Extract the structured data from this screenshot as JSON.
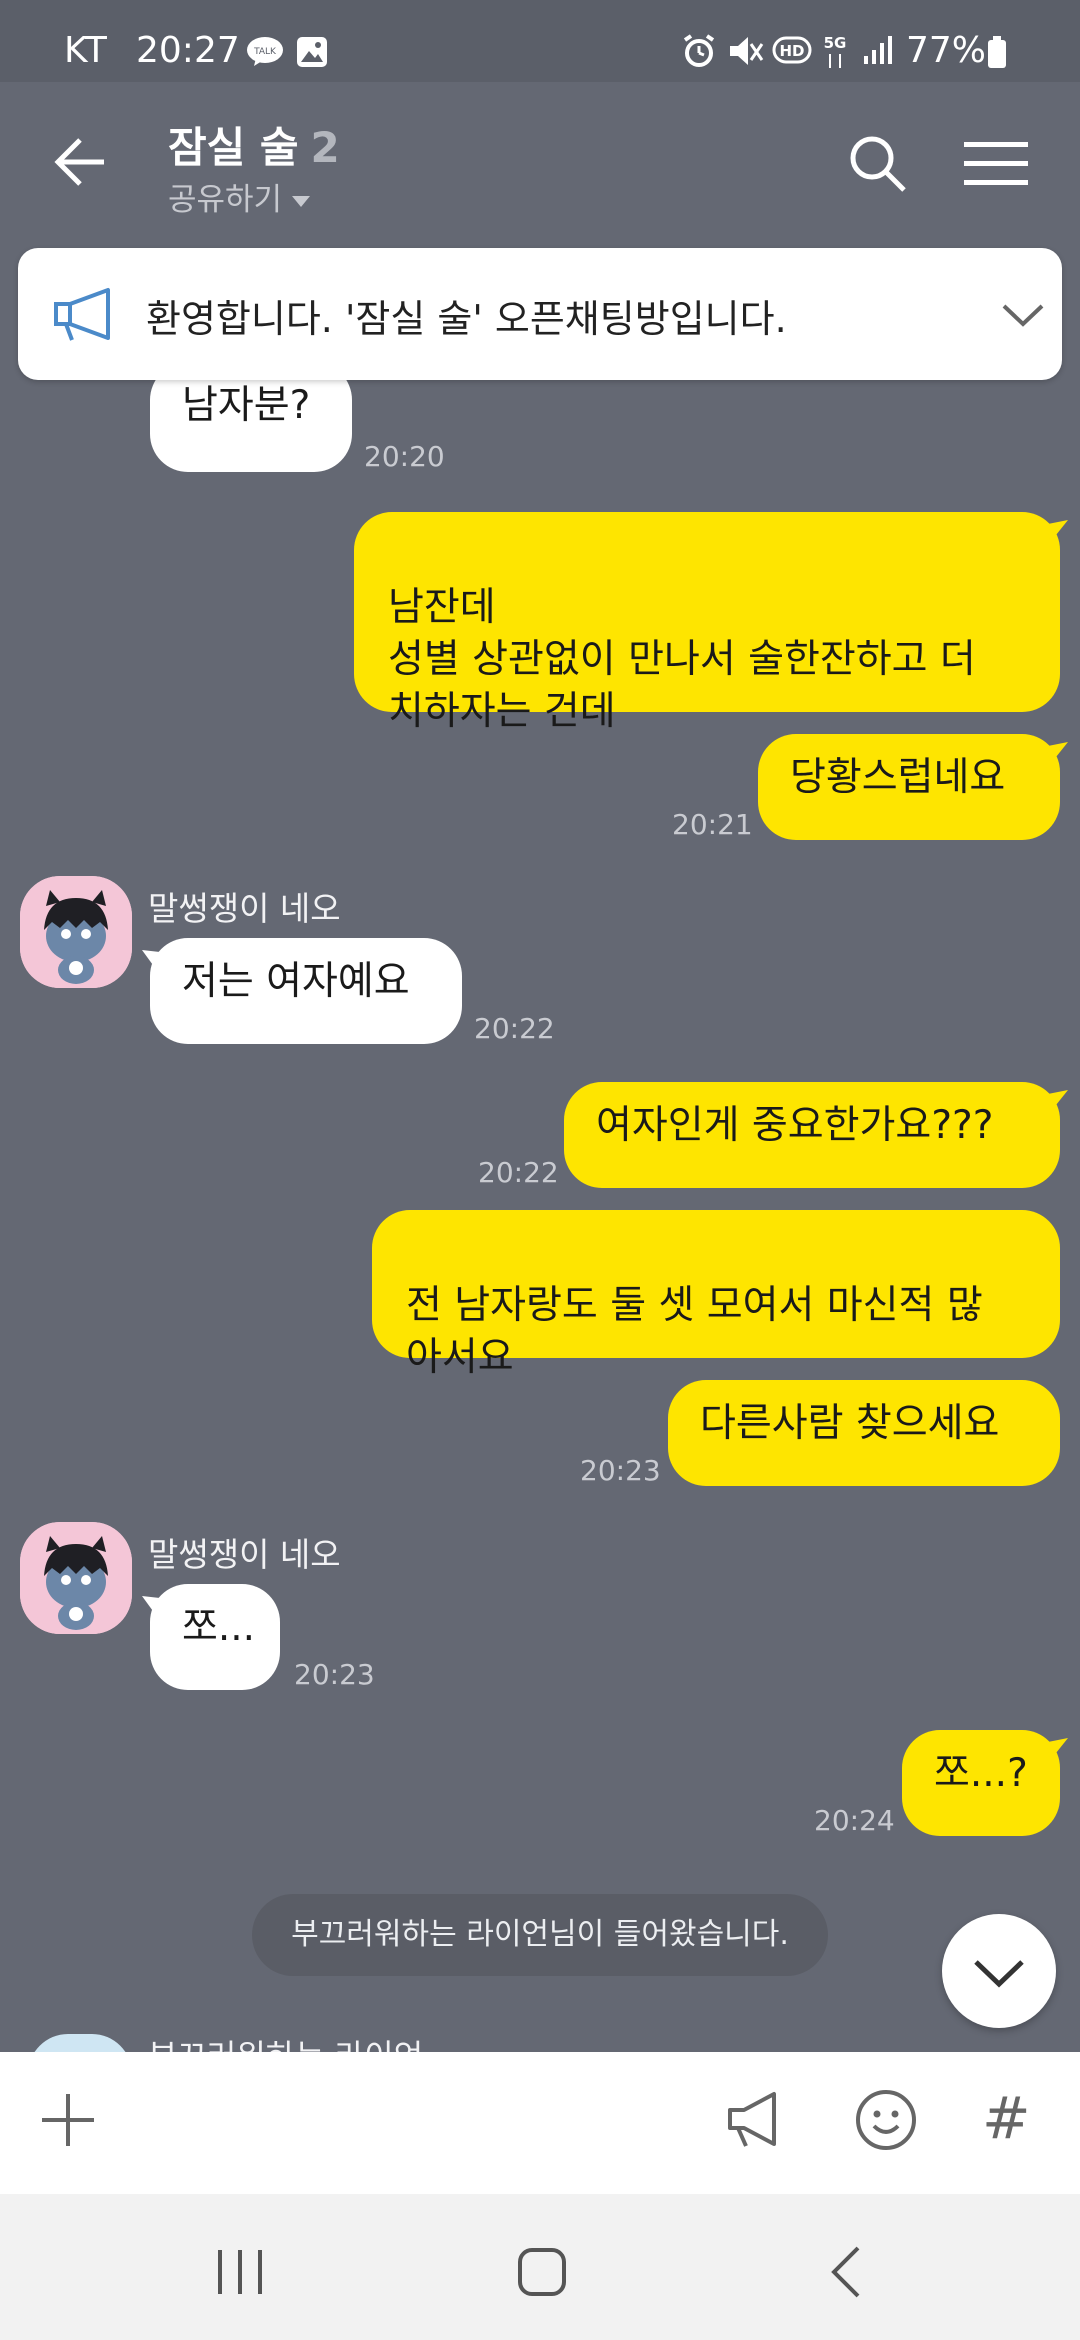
{
  "status_bar": {
    "carrier": "KT",
    "time": "20:27",
    "battery": "77%",
    "icons": [
      "talk-notification-icon",
      "image-notification-icon",
      "alarm-icon",
      "mute-icon",
      "hd-icon",
      "5g-icon",
      "signal-icon",
      "battery-icon"
    ]
  },
  "header": {
    "title": "잠실 술",
    "member_count": "2",
    "subtitle": "공유하기"
  },
  "notice": {
    "text": "환영합니다. '잠실 술' 오픈채팅방입니다."
  },
  "messages": {
    "m1": {
      "text": "남자분?",
      "time": "20:20"
    },
    "m2": {
      "text": "남잔데\n성별 상관없이 만나서 술한잔하고 더\n치하자는 건데"
    },
    "m3": {
      "text": "당황스럽네요",
      "time": "20:21"
    },
    "m4": {
      "sender": "말썽쟁이 네오",
      "text": "저는 여자예요",
      "time": "20:22"
    },
    "m5": {
      "text": "여자인게 중요한가요???",
      "time": "20:22"
    },
    "m6": {
      "text": "전 남자랑도 둘 셋 모여서 마신적 많\n아서요"
    },
    "m7": {
      "text": "다른사람 찾으세요",
      "time": "20:23"
    },
    "m8": {
      "sender": "말썽쟁이 네오",
      "text": "쪼...",
      "time": "20:23"
    },
    "m9": {
      "text": "쪼...?",
      "time": "20:24"
    }
  },
  "system_message": "부끄러워하는 라이언님이 들어왔습니다.",
  "peek_sender": "부끄러워하는 라이언",
  "colors": {
    "background": "#646873",
    "outgoing_bubble": "#fee500",
    "incoming_bubble": "#ffffff"
  }
}
